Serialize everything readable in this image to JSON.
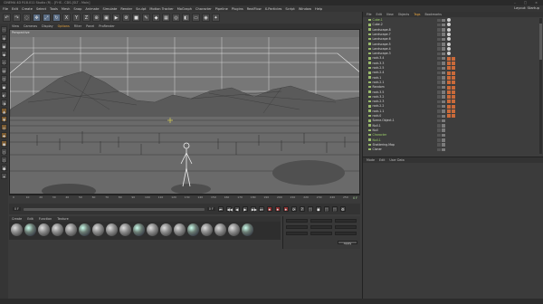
{
  "titlebar": {
    "title": "CINEMA 4D R18.011 Studio (R) - [Fi·lS - CDS-[SLT - Main]",
    "controls": "– □ ×"
  },
  "menubar": {
    "items": [
      "File",
      "Edit",
      "Create",
      "Select",
      "Tools",
      "Mesh",
      "Snap",
      "Animate",
      "Simulate",
      "Render",
      "Sculpt",
      "Motion Tracker",
      "MoGraph",
      "Character",
      "Pipeline",
      "Plugins",
      "RealFlow",
      "X-Particles",
      "Script",
      "Window",
      "Help"
    ],
    "layout_label": "Layout:",
    "layout_value": "Startup"
  },
  "toolbar": {
    "icons": [
      "undo-icon",
      "redo-icon",
      "live-selection-icon",
      "move-icon",
      "scale-icon",
      "rotate-icon",
      "x-axis-icon",
      "y-axis-icon",
      "z-axis-icon",
      "coord-system-icon",
      "render-view-icon",
      "render-icon",
      "render-settings-icon",
      "cube-icon",
      "pen-icon",
      "subdivision-icon",
      "array-icon",
      "null-icon",
      "deformer-icon",
      "floor-icon",
      "camera-icon",
      "light-icon"
    ],
    "glyphs": [
      "↶",
      "↷",
      "◌",
      "✥",
      "⤢",
      "↻",
      "X",
      "Y",
      "Z",
      "⊕",
      "▣",
      "▶",
      "⚙",
      "■",
      "✎",
      "◆",
      "▦",
      "◎",
      "◧",
      "▭",
      "◉",
      "✦"
    ]
  },
  "left_tools": {
    "glyphs": [
      "⬚",
      "◈",
      "▣",
      "◆",
      "◇",
      "▤",
      "◫",
      "●",
      "◐",
      "◑",
      "▲",
      "▼",
      "◎",
      "✚",
      "◼",
      "◻",
      "⬡",
      "⬢",
      "✦"
    ]
  },
  "viewport_menu": {
    "items": [
      "View",
      "Cameras",
      "Display",
      "Options",
      "Filter",
      "Panel",
      "ProRender"
    ],
    "active": "Options",
    "label": "Perspective"
  },
  "timeline": {
    "frame_label": "0 F",
    "ticks": [
      "0",
      "10",
      "20",
      "30",
      "40",
      "50",
      "60",
      "70",
      "80",
      "90",
      "100",
      "110",
      "120",
      "130",
      "140",
      "150",
      "160",
      "170",
      "180",
      "190",
      "200",
      "210",
      "220",
      "230",
      "240",
      "250"
    ]
  },
  "transport": {
    "start_field": "0 F",
    "end_field": "0 F",
    "buttons": [
      "⏮",
      "◀◀",
      "◀",
      "▶",
      "▶▶",
      "⏭",
      "⏺",
      "⏺",
      "⏺",
      "⟳",
      "?",
      "⬚",
      "◼",
      "⬚",
      "⬚",
      "⚙"
    ]
  },
  "material_manager": {
    "menu": [
      "Create",
      "Edit",
      "Function",
      "Texture"
    ],
    "count": 18
  },
  "coordinates": {
    "apply_label": "Apply"
  },
  "object_manager": {
    "menu": [
      "File",
      "Edit",
      "View",
      "Objects",
      "Tags",
      "Bookmarks"
    ],
    "active": "Tags",
    "rows": [
      {
        "name": "Cube.1",
        "green": true
      },
      {
        "name": "Cube.2",
        "green": false
      },
      {
        "name": "Landscape.8",
        "green": false
      },
      {
        "name": "Landscape.7",
        "green": false
      },
      {
        "name": "Landscape.6",
        "green": false
      },
      {
        "name": "Landscape.5",
        "green": false
      },
      {
        "name": "Landscape.4",
        "green": false
      },
      {
        "name": "Landscape.3",
        "green": false
      },
      {
        "name": "rock.3.4",
        "green": false
      },
      {
        "name": "rock.3.3",
        "green": false
      },
      {
        "name": "rock.2.5",
        "green": false
      },
      {
        "name": "rock.2.4",
        "green": false
      },
      {
        "name": "rock.1",
        "green": false
      },
      {
        "name": "rock.2.1",
        "green": false
      },
      {
        "name": "Random",
        "green": false
      },
      {
        "name": "rock.3.5",
        "green": false
      },
      {
        "name": "rock.3.2",
        "green": false
      },
      {
        "name": "rock.2.3",
        "green": false
      },
      {
        "name": "rock.2.2",
        "green": false
      },
      {
        "name": "rock.1.1",
        "green": false
      },
      {
        "name": "rock.0",
        "green": false
      },
      {
        "name": "Scene.Object.1",
        "green": false
      },
      {
        "name": "Null.1",
        "green": false
      },
      {
        "name": "Null",
        "green": false
      },
      {
        "name": "Character",
        "green": true
      },
      {
        "name": "Null.1",
        "green": true
      },
      {
        "name": "Shattering.Map",
        "green": false
      },
      {
        "name": "Cloner",
        "green": false
      }
    ]
  },
  "attribute_manager": {
    "menu": [
      "Mode",
      "Edit",
      "User Data"
    ]
  }
}
